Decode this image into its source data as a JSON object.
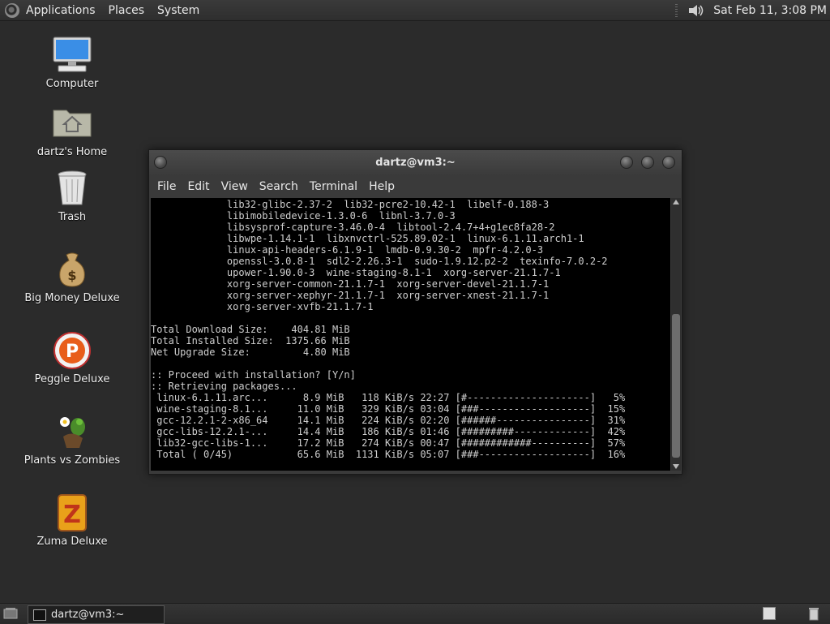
{
  "top_panel": {
    "menus": [
      "Applications",
      "Places",
      "System"
    ],
    "clock": "Sat Feb 11,  3:08 PM"
  },
  "desktop": {
    "icons": [
      {
        "label": "Computer",
        "icon": "computer-icon"
      },
      {
        "label": "dartz's Home",
        "icon": "home-folder-icon"
      },
      {
        "label": "Trash",
        "icon": "trash-icon"
      },
      {
        "label": "Big Money Deluxe",
        "icon": "money-bag-icon"
      },
      {
        "label": "Peggle Deluxe",
        "icon": "peggle-icon"
      },
      {
        "label": "Plants vs Zombies",
        "icon": "plants-vs-zombies-icon"
      },
      {
        "label": "Zuma Deluxe",
        "icon": "zuma-icon"
      }
    ]
  },
  "terminal": {
    "title": "dartz@vm3:~",
    "menu": [
      "File",
      "Edit",
      "View",
      "Search",
      "Terminal",
      "Help"
    ],
    "lines": [
      "             lib32-glibc-2.37-2  lib32-pcre2-10.42-1  libelf-0.188-3",
      "             libimobiledevice-1.3.0-6  libnl-3.7.0-3",
      "             libsysprof-capture-3.46.0-4  libtool-2.4.7+4+g1ec8fa28-2",
      "             libwpe-1.14.1-1  libxnvctrl-525.89.02-1  linux-6.1.11.arch1-1",
      "             linux-api-headers-6.1.9-1  lmdb-0.9.30-2  mpfr-4.2.0-3",
      "             openssl-3.0.8-1  sdl2-2.26.3-1  sudo-1.9.12.p2-2  texinfo-7.0.2-2",
      "             upower-1.90.0-3  wine-staging-8.1-1  xorg-server-21.1.7-1",
      "             xorg-server-common-21.1.7-1  xorg-server-devel-21.1.7-1",
      "             xorg-server-xephyr-21.1.7-1  xorg-server-xnest-21.1.7-1",
      "             xorg-server-xvfb-21.1.7-1",
      "",
      "Total Download Size:    404.81 MiB",
      "Total Installed Size:  1375.66 MiB",
      "Net Upgrade Size:         4.80 MiB",
      "",
      ":: Proceed with installation? [Y/n]",
      ":: Retrieving packages...",
      " linux-6.1.11.arc...      8.9 MiB   118 KiB/s 22:27 [#---------------------]   5%",
      " wine-staging-8.1...     11.0 MiB   329 KiB/s 03:04 [###-------------------]  15%",
      " gcc-12.2.1-2-x86_64     14.1 MiB   224 KiB/s 02:20 [######----------------]  31%",
      " gcc-libs-12.2.1-...     14.4 MiB   186 KiB/s 01:46 [#########-------------]  42%",
      " lib32-gcc-libs-1...     17.2 MiB   274 KiB/s 00:47 [############----------]  57%",
      " Total ( 0/45)           65.6 MiB  1131 KiB/s 05:07 [###-------------------]  16%"
    ]
  },
  "bottom_panel": {
    "task_label": "dartz@vm3:~"
  }
}
